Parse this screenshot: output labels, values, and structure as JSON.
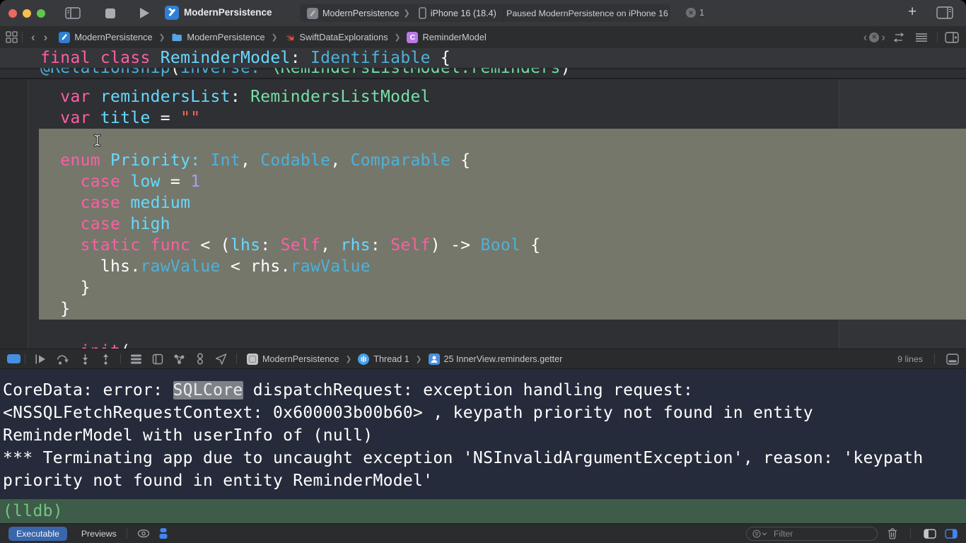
{
  "window": {
    "title": "ModernPersistence"
  },
  "toolbar": {
    "scheme": {
      "project": "ModernPersistence",
      "destination": "iPhone 16 (18.4)"
    },
    "status": "Paused ModernPersistence on iPhone 16",
    "error_count": "1"
  },
  "jumpbar": {
    "items": [
      {
        "icon": "project-icon",
        "label": "ModernPersistence"
      },
      {
        "icon": "folder-icon",
        "label": "ModernPersistence"
      },
      {
        "icon": "swift-file-icon",
        "label": "SwiftDataExplorations"
      },
      {
        "icon": "class-icon",
        "label": "ReminderModel"
      }
    ]
  },
  "editor": {
    "sticky": [
      [
        "final class ",
        "kw"
      ],
      [
        "ReminderModel",
        "decl"
      ],
      [
        ": ",
        "plain"
      ],
      [
        "Identifiable",
        "typ"
      ],
      [
        " {",
        "plain"
      ]
    ],
    "clipped": [
      [
        "@Relationship",
        "typ"
      ],
      [
        "(",
        "plain"
      ],
      [
        "inverse:",
        "typ"
      ],
      [
        " ",
        "plain"
      ],
      [
        "\\RemindersListModel.reminders",
        "proj"
      ],
      [
        ")",
        "plain"
      ]
    ],
    "selection": {
      "start": 2,
      "end": 10
    },
    "lines": [
      [
        [
          "  var",
          "kw"
        ],
        [
          " remindersList",
          "decl"
        ],
        [
          ": ",
          "plain"
        ],
        [
          "RemindersListModel",
          "proj"
        ]
      ],
      [
        [
          "  var",
          "kw"
        ],
        [
          " title",
          "decl"
        ],
        [
          " = ",
          "plain"
        ],
        [
          "\"\"",
          "str"
        ]
      ],
      [],
      [
        [
          "  enum",
          "kw"
        ],
        [
          " Priority:",
          "decl"
        ],
        [
          " ",
          "plain"
        ],
        [
          "Int",
          "typ"
        ],
        [
          ", ",
          "plain"
        ],
        [
          "Codable",
          "typ"
        ],
        [
          ", ",
          "plain"
        ],
        [
          "Comparable",
          "typ"
        ],
        [
          " {",
          "plain"
        ]
      ],
      [
        [
          "    case",
          "kw"
        ],
        [
          " low",
          "decl"
        ],
        [
          " = ",
          "plain"
        ],
        [
          "1",
          "num"
        ]
      ],
      [
        [
          "    case",
          "kw"
        ],
        [
          " medium",
          "decl"
        ]
      ],
      [
        [
          "    case",
          "kw"
        ],
        [
          " high",
          "decl"
        ]
      ],
      [
        [
          "    static func",
          "kw"
        ],
        [
          " < (",
          "plain"
        ],
        [
          "lhs",
          "decl"
        ],
        [
          ": ",
          "plain"
        ],
        [
          "Self",
          "kw"
        ],
        [
          ", ",
          "plain"
        ],
        [
          "rhs",
          "decl"
        ],
        [
          ": ",
          "plain"
        ],
        [
          "Self",
          "kw"
        ],
        [
          ") -> ",
          "plain"
        ],
        [
          "Bool",
          "typ"
        ],
        [
          " {",
          "plain"
        ]
      ],
      [
        [
          "      lhs",
          "plain"
        ],
        [
          ".",
          "plain"
        ],
        [
          "rawValue",
          "typ"
        ],
        [
          " < ",
          "plain"
        ],
        [
          "rhs",
          "plain"
        ],
        [
          ".",
          "plain"
        ],
        [
          "rawValue",
          "typ"
        ]
      ],
      [
        [
          "    }",
          "plain"
        ]
      ],
      [
        [
          "  }",
          "plain"
        ]
      ],
      [],
      [
        [
          "    init",
          "kw"
        ],
        [
          "(",
          "plain"
        ]
      ]
    ]
  },
  "debugbar": {
    "breadcrumb": [
      {
        "icon": "app-icon",
        "label": "ModernPersistence"
      },
      {
        "icon": "thread-icon",
        "label": "Thread 1"
      },
      {
        "icon": "stack-frame-icon",
        "label": "25 InnerView.reminders.getter"
      }
    ],
    "line_count": "9 lines"
  },
  "console": {
    "lines": [
      [
        [
          "CoreData: error: ",
          "plain"
        ],
        [
          "SQLCore",
          "hl"
        ],
        [
          " dispatchRequest: exception handling request:",
          "plain"
        ]
      ],
      [
        [
          "<NSSQLFetchRequestContext: 0x600003b00b60> , keypath priority not found in entity",
          "plain"
        ]
      ],
      [
        [
          "ReminderModel with userInfo of (null)",
          "plain"
        ]
      ],
      [
        [
          "*** Terminating app due to uncaught exception 'NSInvalidArgumentException', reason: 'keypath",
          "plain"
        ]
      ],
      [
        [
          "priority not found in entity ReminderModel'",
          "plain"
        ]
      ]
    ],
    "prompt": "(lldb)"
  },
  "bottombar": {
    "tabs": [
      "Executable",
      "Previews"
    ],
    "filter_placeholder": "Filter"
  },
  "colors": {
    "accent_blue": "#3a66ab",
    "selection_olive": "#75776b",
    "console_bg": "#262b3b",
    "lldb_bg": "#3e5c49",
    "lldb_text": "#74c57f",
    "keyword_pink": "#fc5fa3",
    "decl_cyan": "#66d9ff",
    "type_blue": "#4fb1d8",
    "project_type_green": "#74e1a6",
    "string_red": "#fc6a5d",
    "number_purple": "#a79df1"
  }
}
